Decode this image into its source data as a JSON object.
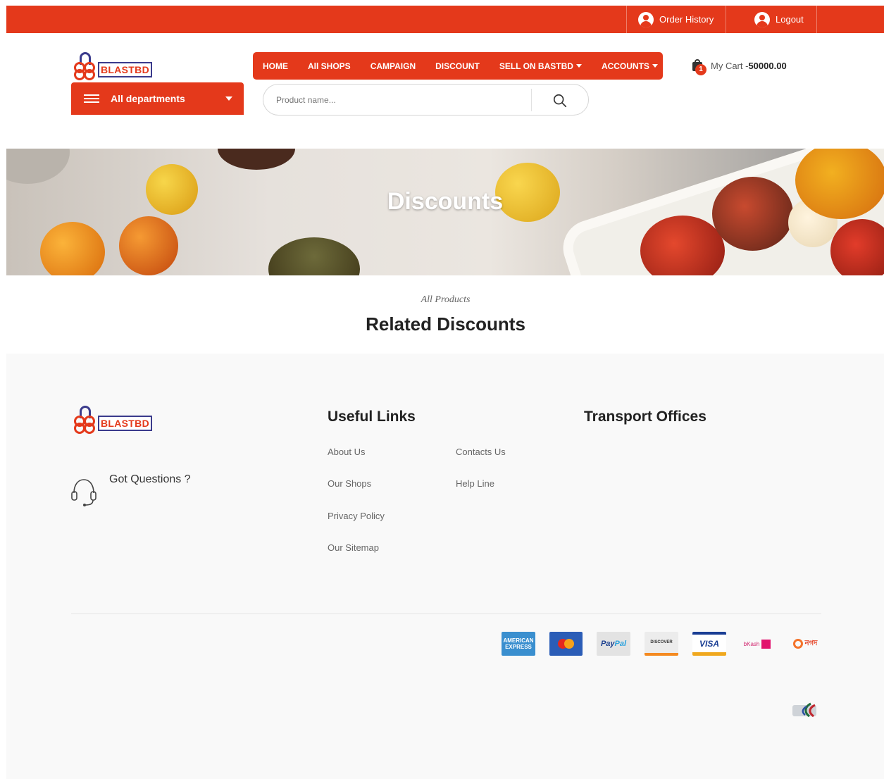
{
  "topbar": {
    "order_history": "Order History",
    "logout": "Logout"
  },
  "brand": {
    "logo_text": "BLASTBD",
    "accent_color": "#e4391b",
    "secondary_color": "#3b3b8c"
  },
  "departments": {
    "label": "All departments"
  },
  "nav": {
    "items": [
      {
        "label": "HOME"
      },
      {
        "label": "All SHOPS"
      },
      {
        "label": "CAMPAIGN"
      },
      {
        "label": "DISCOUNT"
      },
      {
        "label": "SELL ON BASTBD"
      },
      {
        "label": "ACCOUNTS"
      }
    ]
  },
  "search": {
    "placeholder": "Product name..."
  },
  "cart": {
    "count": "1",
    "label": "My Cart -",
    "amount": "50000.00"
  },
  "banner": {
    "title": "Discounts"
  },
  "section": {
    "subtitle": "All Products",
    "title": "Related Discounts"
  },
  "footer": {
    "got_questions": "Got Questions ?",
    "useful_links_heading": "Useful Links",
    "transport_heading": "Transport Offices",
    "links": [
      {
        "label": "About Us"
      },
      {
        "label": "Contacts Us"
      },
      {
        "label": "Our Shops"
      },
      {
        "label": "Help Line"
      },
      {
        "label": "Privacy Policy"
      },
      {
        "label": "Our Sitemap"
      }
    ],
    "payments": {
      "amex": "AMERICAN EXPRESS",
      "paypal_a": "Pay",
      "paypal_b": "Pal",
      "discover": "DISCOVER",
      "visa": "VISA",
      "bkash": "bKash",
      "nagad": "নগদ"
    }
  }
}
